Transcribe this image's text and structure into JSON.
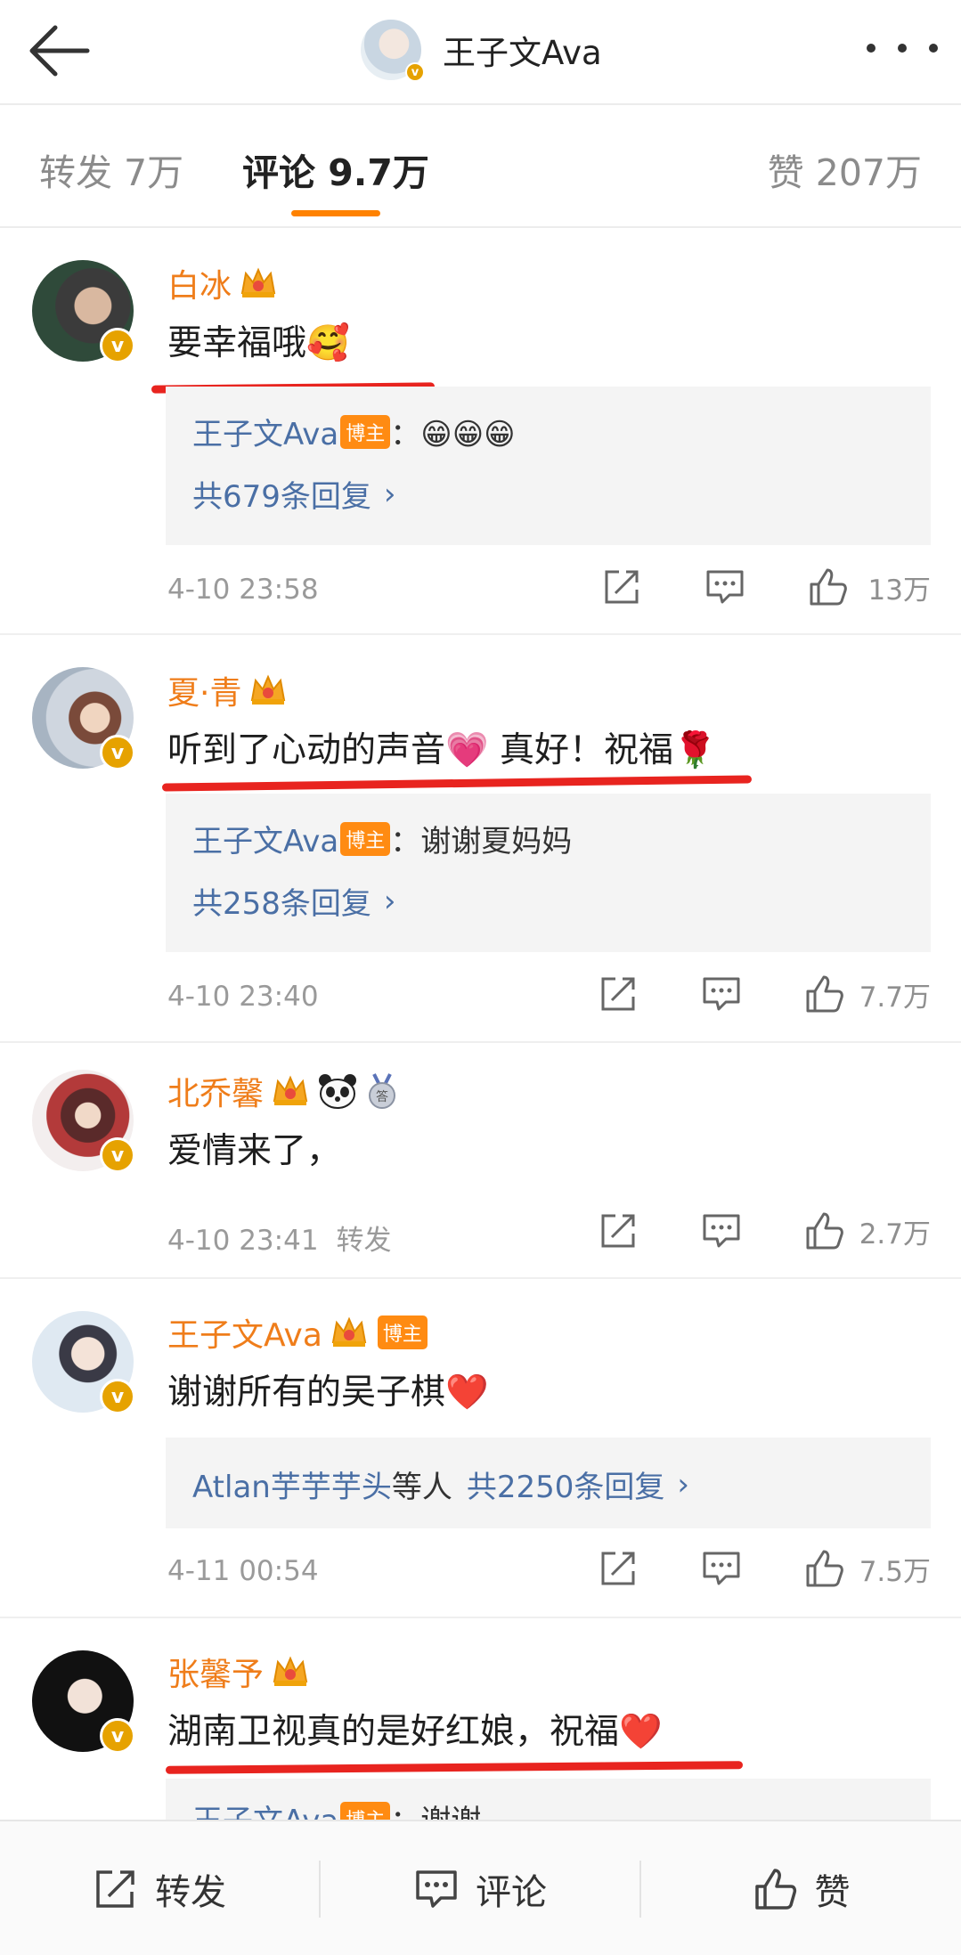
{
  "header": {
    "title": "王子文Ava"
  },
  "tabs": {
    "repost": "转发 7万",
    "comment": "评论 9.7万",
    "like": "赞 207万"
  },
  "colors": {
    "accent": "#ff8200",
    "username": "#ef7d1a",
    "link": "#4a6fa5",
    "annotation": "#e8241f",
    "verified": "#e6a200"
  },
  "comments": [
    {
      "name": "白冰",
      "text": "要幸福哦🥰",
      "reply_author": "王子文Ava",
      "reply_badge": "博主",
      "reply_text": "：😁😁😁",
      "reply_count": "共679条回复",
      "time": "4-10 23:58",
      "likes": "13万"
    },
    {
      "name": "夏·青",
      "text": "听到了心动的声音💗 真好！祝福🌹",
      "reply_author": "王子文Ava",
      "reply_badge": "博主",
      "reply_text": "：谢谢夏妈妈",
      "reply_count": "共258条回复",
      "time": "4-10 23:40",
      "likes": "7.7万"
    },
    {
      "name": "北乔馨",
      "text": "爱情来了，",
      "time": "4-10 23:41",
      "repost_label": "转发",
      "likes": "2.7万"
    },
    {
      "name": "王子文Ava",
      "badge": "博主",
      "text": "谢谢所有的吴子棋❤️",
      "reply_users": "Atlan芋芋芋头",
      "reply_users_suffix": "等人",
      "reply_count": "共2250条回复",
      "time": "4-11 00:54",
      "likes": "7.5万"
    },
    {
      "name": "张馨予",
      "text": "湖南卫视真的是好红娘，祝福❤️",
      "reply_author": "王子文Ava",
      "reply_badge": "博主",
      "reply_text": "：谢谢"
    }
  ],
  "bottom_bar": {
    "repost": "转发",
    "comment": "评论",
    "like": "赞"
  },
  "icons": [
    "back-arrow-icon",
    "more-icon",
    "crown-icon",
    "panda-icon",
    "medal-icon",
    "share-icon",
    "comment-icon",
    "like-icon",
    "verified-icon"
  ]
}
